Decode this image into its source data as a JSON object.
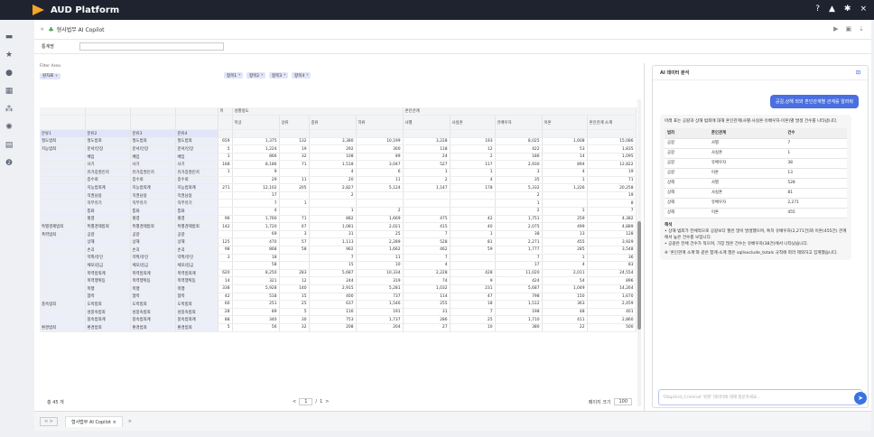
{
  "app": {
    "title": "AUD Platform",
    "help": "?",
    "user": "▲",
    "settings": "✱",
    "close": "×"
  },
  "doc": {
    "title": "형사법무 AI Copilot"
  },
  "filter": {
    "label": "통계명",
    "area": "Filter Area"
  },
  "grid": {
    "row_zone": "원자료",
    "col_pills": [
      "항목1",
      "항목2",
      "항목3",
      "항목4"
    ],
    "row_heads": [
      "분류1",
      "분류2",
      "분류3",
      "분류4"
    ],
    "col_group1": "미",
    "col_group2": "성황정도",
    "col_group3": "혼인관계",
    "col_heads": [
      "미상",
      "상류",
      "중류",
      "하류",
      "사별",
      "사실혼",
      "유배우자",
      "이혼",
      "혼인관계 소계"
    ],
    "rows": [
      [
        "절도범죄",
        "절도범죄",
        "절도범죄",
        "절도범죄",
        "659",
        "1,375",
        "132",
        "3,380",
        "10,199",
        "3,228",
        "193",
        "8,025",
        "1,608",
        "15,086"
      ],
      [
        "지능범죄",
        "문서/인장",
        "문서/인장",
        "문서/인장",
        "5",
        "1,224",
        "19",
        "292",
        "300",
        "118",
        "12",
        "422",
        "53",
        "1,835"
      ],
      [
        "",
        "배임",
        "배임",
        "배임",
        "1",
        "866",
        "32",
        "108",
        "89",
        "24",
        "2",
        "186",
        "14",
        "1,095"
      ],
      [
        "",
        "사기",
        "사기",
        "사기",
        "168",
        "8,186",
        "71",
        "1,518",
        "3,047",
        "527",
        "117",
        "2,930",
        "894",
        "12,822"
      ],
      [
        "",
        "유가증권인지",
        "유가증권인지",
        "유가증권인지",
        "1",
        "9",
        "",
        "4",
        "6",
        "1",
        "1",
        "3",
        "4",
        "19"
      ],
      [
        "",
        "증수뢰",
        "증수뢰",
        "증수뢰",
        "",
        "29",
        "11",
        "20",
        "11",
        "2",
        "4",
        "35",
        "1",
        "71"
      ],
      [
        "",
        "지능범죄계",
        "지능범죄계",
        "지능범죄계",
        "271",
        "12,102",
        "205",
        "2,827",
        "5,124",
        "1,147",
        "178",
        "5,332",
        "1,226",
        "20,258"
      ],
      [
        "",
        "직권남용",
        "직권남용",
        "직권남용",
        "",
        "17",
        "",
        "2",
        "",
        "",
        "",
        "2",
        "",
        "19"
      ],
      [
        "",
        "직무유기",
        "직무유기",
        "직무유기",
        "",
        "7",
        "1",
        "",
        "",
        "",
        "",
        "1",
        "",
        "8"
      ],
      [
        "",
        "통화",
        "통화",
        "통화",
        "",
        "4",
        "",
        "1",
        "2",
        "",
        "",
        "2",
        "1",
        "7"
      ],
      [
        "",
        "횡령",
        "횡령",
        "횡령",
        "96",
        "1,760",
        "71",
        "882",
        "1,669",
        "475",
        "42",
        "1,751",
        "259",
        "4,382"
      ],
      [
        "특별경제범죄",
        "특별경제범죄",
        "특별경제범죄",
        "특별경제범죄",
        "142",
        "1,720",
        "67",
        "1,081",
        "2,021",
        "415",
        "40",
        "2,075",
        "499",
        "4,889"
      ],
      [
        "폭력범죄",
        "공갈",
        "공갈",
        "공갈",
        "",
        "69",
        "3",
        "31",
        "25",
        "7",
        "1",
        "38",
        "13",
        "128"
      ],
      [
        "",
        "상해",
        "상해",
        "상해",
        "125",
        "470",
        "57",
        "1,113",
        "2,289",
        "528",
        "81",
        "2,271",
        "455",
        "3,929"
      ],
      [
        "",
        "손괴",
        "손괴",
        "손괴",
        "98",
        "868",
        "58",
        "962",
        "1,662",
        "462",
        "59",
        "1,777",
        "285",
        "3,548"
      ],
      [
        "",
        "약취/유인",
        "약취/유인",
        "약취/유인",
        "3",
        "18",
        "",
        "7",
        "11",
        "7",
        "",
        "7",
        "1",
        "36"
      ],
      [
        "",
        "체포/감금",
        "체포/감금",
        "체포/감금",
        "",
        "58",
        "",
        "15",
        "10",
        "4",
        "",
        "17",
        "4",
        "83"
      ],
      [
        "",
        "폭력범죄계",
        "폭력범죄계",
        "폭력범죄계",
        "620",
        "8,250",
        "283",
        "5,687",
        "10,334",
        "2,228",
        "428",
        "11,020",
        "2,011",
        "24,554"
      ],
      [
        "",
        "폭력행위등",
        "폭력행위등",
        "폭력행위등",
        "14",
        "321",
        "12",
        "244",
        "319",
        "74",
        "9",
        "424",
        "54",
        "896"
      ],
      [
        "",
        "폭행",
        "폭행",
        "폭행",
        "338",
        "5,928",
        "140",
        "2,915",
        "5,281",
        "1,032",
        "231",
        "5,687",
        "1,049",
        "14,264"
      ],
      [
        "",
        "협박",
        "협박",
        "협박",
        "42",
        "518",
        "15",
        "400",
        "737",
        "114",
        "47",
        "798",
        "150",
        "1,670"
      ],
      [
        "풍속범죄",
        "도박범죄",
        "도박범죄",
        "도박범죄",
        "60",
        "251",
        "25",
        "637",
        "1,546",
        "255",
        "18",
        "1,512",
        "363",
        "2,459"
      ],
      [
        "",
        "성풍속범죄",
        "성풍속범죄",
        "성풍속범죄",
        "28",
        "89",
        "5",
        "116",
        "191",
        "31",
        "7",
        "198",
        "48",
        "401"
      ],
      [
        "",
        "풍속범죄계",
        "풍속범죄계",
        "풍속범죄계",
        "88",
        "340",
        "30",
        "753",
        "1,737",
        "286",
        "25",
        "1,710",
        "411",
        "2,860"
      ],
      [
        "환경범죄",
        "환경범죄",
        "환경범죄",
        "환경범죄",
        "5",
        "56",
        "32",
        "208",
        "204",
        "27",
        "10",
        "380",
        "22",
        "500"
      ]
    ],
    "total_label": "총 45 개",
    "page": "1",
    "page_total": "1",
    "page_size_label": "페이지 크기",
    "page_size": "100"
  },
  "ai": {
    "title": "AI 데이터 분석",
    "user_msg": "공갈,상해 죄와 혼인관계별 관계를 알려줘",
    "intro": "아래 표는 공갈과 상해 범죄에 대해 혼인관계(사별·사실혼·유배우자·이혼)별 발생 건수를 나타냅니다.",
    "table_head": [
      "범죄",
      "혼인관계",
      "건수"
    ],
    "table_rows": [
      [
        "공갈",
        "사별",
        "7"
      ],
      [
        "공갈",
        "사실혼",
        "1"
      ],
      [
        "공갈",
        "유배우자",
        "38"
      ],
      [
        "공갈",
        "이혼",
        "13"
      ],
      [
        "상해",
        "사별",
        "528"
      ],
      [
        "상해",
        "사실혼",
        "81"
      ],
      [
        "상해",
        "유배우자",
        "2,271"
      ],
      [
        "상해",
        "이혼",
        "455"
      ]
    ],
    "sec": "해석",
    "b1": "상해 범죄가 전체적으로 공갈보다 월씬 많이 발생했으며, 특히 유배우자(2,271건)와 이혼(455건) 관계에서 높은 건수를 보입니다.",
    "b2": "공갈은 전체 건수가 적으며, 가장 많은 건수는 유배우자(38건)에서 나타났습니다.",
    "note": "※ '혼인관계 소계'와 같은 합계·소계 행은 sql/exclude_totals 규칙에 따라 제외하고 집계했습니다.",
    "input_placeholder": "'OlapGrid_Criminal' 위젯' 데이터에 대해 질문하세요..."
  },
  "tabbar": {
    "nav": "< >",
    "tab": "형사법무 AI Copilot",
    "close": "×"
  }
}
